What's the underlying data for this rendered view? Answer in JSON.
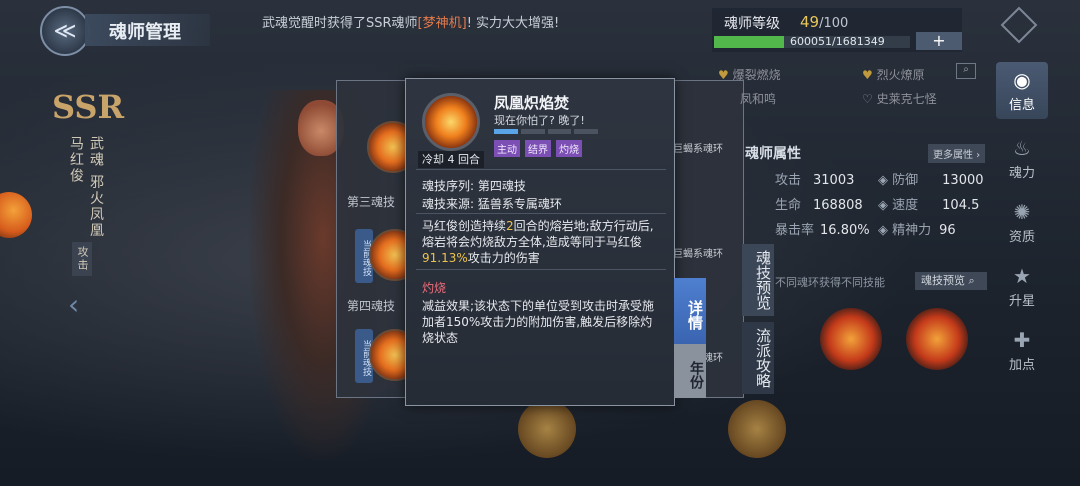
{
  "header": {
    "title": "魂师管理",
    "marquee_prefix": "武魂觉醒时获得了SSR魂师",
    "marquee_name": "[梦神机]",
    "marquee_suffix": "! 实力大大增强!",
    "level_label": "魂师等级",
    "level_value": "49",
    "level_max": "/100",
    "exp_text": "600051/1681349",
    "exp_fraction": 0.357,
    "plus_label": "+"
  },
  "character": {
    "rarity": "SSR",
    "name": "马红俊",
    "spirit": "武魂 邪火凤凰",
    "role": "攻击"
  },
  "skills": {
    "third_label": "第三魂技",
    "fourth_label": "第四魂技",
    "current_tag": "当前魂技",
    "ring_type_1": "巨蝎系魂环",
    "ring_type_2": "巨蝎系魂环",
    "ring_type_3": "巨蝎系魂环"
  },
  "favorites": {
    "item1": "爆裂燃烧",
    "item2": "烈火燎原",
    "item3": "凤和鸣",
    "item4": "史莱克七怪"
  },
  "stats": {
    "title": "魂师属性",
    "more": "更多属性",
    "attack_label": "攻击",
    "attack": "31003",
    "defense_label": "防御",
    "defense": "13000",
    "hp_label": "生命",
    "hp": "168808",
    "speed_label": "速度",
    "speed": "104.5",
    "crit_label": "暴击率",
    "crit": "16.80%",
    "mind_label": "精神力",
    "mind": "96"
  },
  "ring_hint": "不同魂环获得不同技能",
  "ring_preview": "魂技预览",
  "right_tabs": {
    "preview": "魂技预览",
    "strategy": "流派攻略"
  },
  "nav": {
    "info": "信息",
    "soul_power": "魂力",
    "aptitude": "资质",
    "star_up": "升星",
    "bonus": "加点"
  },
  "popup": {
    "name": "凤凰炽焰焚",
    "quote": "现在你怕了? 晚了!",
    "cooldown": "冷却 4 回合",
    "level_fill": 0.25,
    "tags": [
      "主动",
      "结界",
      "灼烧"
    ],
    "order_label": "魂技序列: 第四魂技",
    "source_label": "魂技来源: 猛兽系专属魂环",
    "desc_a": "马红俊创造持续",
    "desc_num1": "2",
    "desc_b": "回合的熔岩地;敌方行动后,熔岩将会灼烧敌方全体,造成等同于马红俊",
    "desc_num2": "91.13%",
    "desc_c": "攻击力的伤害",
    "sub_title": "灼烧",
    "sub_desc": "减益效果;该状态下的单位受到攻击时承受施加者150%攻击力的附加伤害,触发后移除灼烧状态"
  },
  "side_buttons": {
    "detail": "详情",
    "year": "年份"
  },
  "colors": {
    "accent_blue": "#4f7fd0",
    "highlight_gold": "#ecc24a",
    "debuff_red": "#ef6b7a",
    "tag_purple": "#7b4fb4",
    "exp_green": "#53b84b"
  }
}
